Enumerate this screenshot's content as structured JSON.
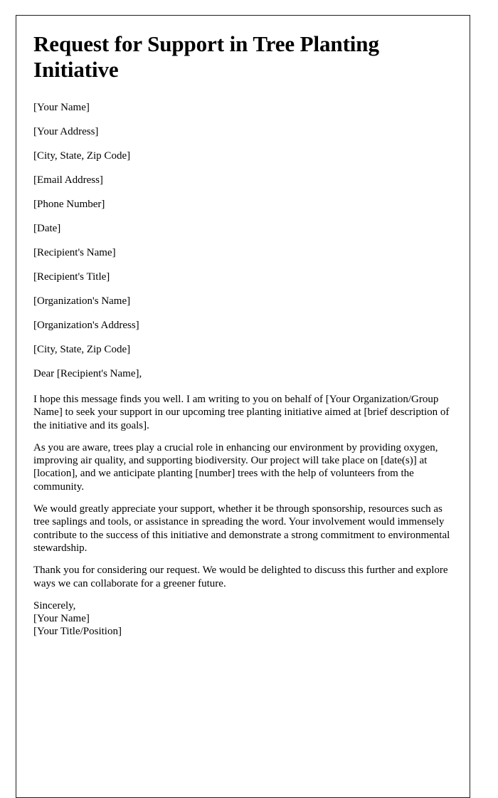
{
  "document": {
    "title": "Request for Support in Tree Planting Initiative",
    "sender_block": [
      "[Your Name]",
      "[Your Address]",
      "[City, State, Zip Code]",
      "[Email Address]",
      "[Phone Number]",
      "[Date]"
    ],
    "recipient_block": [
      "[Recipient's Name]",
      "[Recipient's Title]",
      "[Organization's Name]",
      "[Organization's Address]",
      "[City, State, Zip Code]"
    ],
    "salutation": "Dear [Recipient's Name],",
    "paragraphs": [
      "I hope this message finds you well. I am writing to you on behalf of [Your Organization/Group Name] to seek your support in our upcoming tree planting initiative aimed at [brief description of the initiative and its goals].",
      "As you are aware, trees play a crucial role in enhancing our environment by providing oxygen, improving air quality, and supporting biodiversity. Our project will take place on [date(s)] at [location], and we anticipate planting [number] trees with the help of volunteers from the community.",
      "We would greatly appreciate your support, whether it be through sponsorship, resources such as tree saplings and tools, or assistance in spreading the word. Your involvement would immensely contribute to the success of this initiative and demonstrate a strong commitment to environmental stewardship.",
      "Thank you for considering our request. We would be delighted to discuss this further and explore ways we can collaborate for a greener future."
    ],
    "closing": [
      "Sincerely,",
      "[Your Name]",
      "[Your Title/Position]"
    ]
  }
}
